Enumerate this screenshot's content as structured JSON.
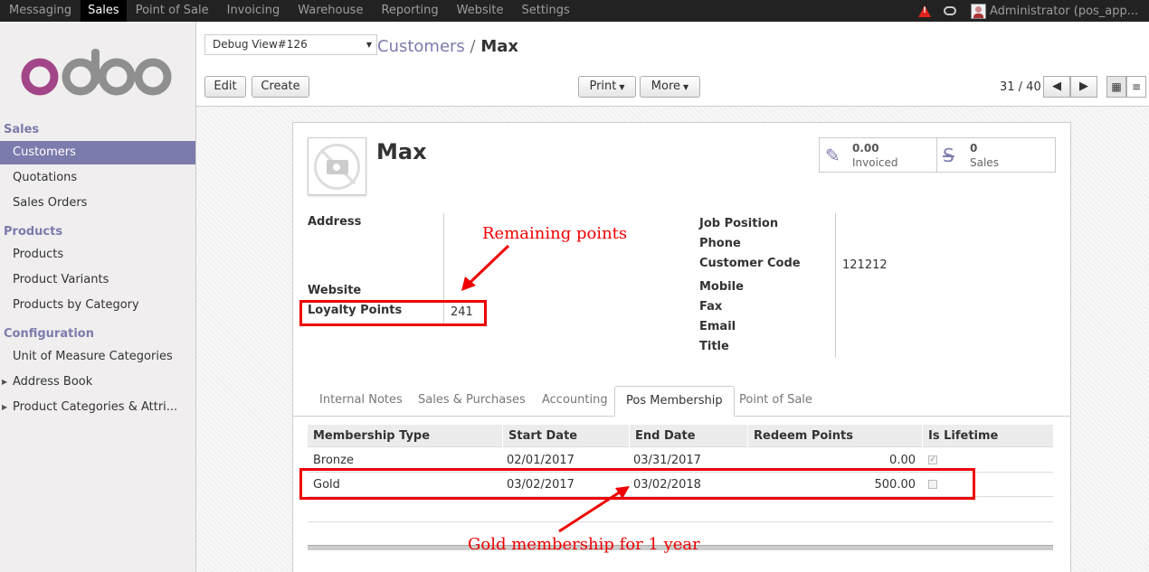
{
  "topbar": {
    "menu": [
      "Messaging",
      "Sales",
      "Point of Sale",
      "Invoicing",
      "Warehouse",
      "Reporting",
      "Website",
      "Settings"
    ],
    "active": "Sales",
    "user": "Administrator (pos_app..."
  },
  "sidebar": {
    "sections": [
      {
        "title": "Sales",
        "items": [
          "Customers",
          "Quotations",
          "Sales Orders"
        ]
      },
      {
        "title": "Products",
        "items": [
          "Products",
          "Product Variants",
          "Products by Category"
        ]
      },
      {
        "title": "Configuration",
        "items": [
          "Unit of Measure Categories",
          "Address Book",
          "Product Categories & Attri..."
        ]
      }
    ],
    "active_item": "Customers"
  },
  "control": {
    "debug": "Debug View#126",
    "breadcrumb_parent": "Customers",
    "breadcrumb_sep": "/",
    "breadcrumb_current": "Max",
    "edit": "Edit",
    "create": "Create",
    "print": "Print",
    "more": "More",
    "pager": "31 / 40"
  },
  "record": {
    "name": "Max",
    "invoiced_value": "0.00",
    "invoiced_label": "Invoiced",
    "sales_value": "0",
    "sales_label": "Sales",
    "left_labels": {
      "address": "Address",
      "website": "Website",
      "loyalty": "Loyalty Points"
    },
    "loyalty_points": "241",
    "right_labels": {
      "job": "Job Position",
      "phone": "Phone",
      "code": "Customer Code",
      "mobile": "Mobile",
      "fax": "Fax",
      "email": "Email",
      "title": "Title"
    },
    "customer_code": "121212"
  },
  "tabs": [
    "Internal Notes",
    "Sales & Purchases",
    "Accounting",
    "Pos Membership",
    "Point of Sale"
  ],
  "active_tab": "Pos Membership",
  "table": {
    "headers": [
      "Membership Type",
      "Start Date",
      "End Date",
      "Redeem Points",
      "Is Lifetime"
    ],
    "rows": [
      {
        "type": "Bronze",
        "start": "02/01/2017",
        "end": "03/31/2017",
        "points": "0.00",
        "lifetime": true
      },
      {
        "type": "Gold",
        "start": "03/02/2017",
        "end": "03/02/2018",
        "points": "500.00",
        "lifetime": false
      }
    ]
  },
  "annotations": {
    "remaining": "Remaining points",
    "gold": "Gold membership for 1 year"
  },
  "colors": {
    "brand": "#7c7bad",
    "annotation": "#ee0000",
    "topbar": "#222222"
  }
}
